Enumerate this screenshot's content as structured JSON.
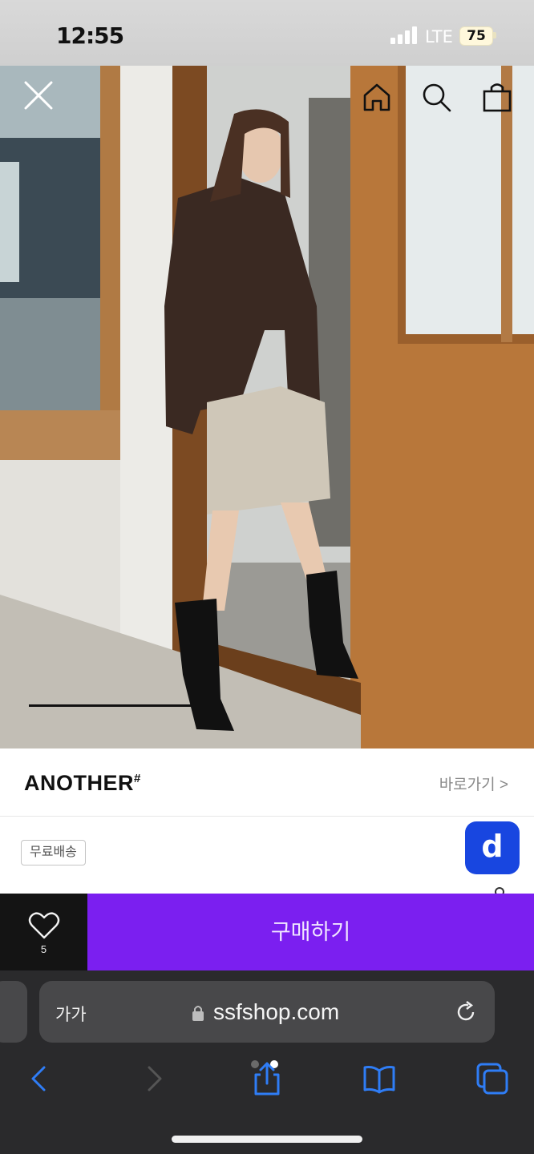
{
  "status_bar": {
    "time": "12:55",
    "network": "LTE",
    "battery": "75"
  },
  "top_icons": [
    "close-icon",
    "home-icon",
    "search-icon",
    "shopping-bag-icon"
  ],
  "brand": {
    "name": "ANOTHER",
    "mark": "#",
    "link": "바로가기 >"
  },
  "badges": {
    "shipping": "무료배송",
    "app": "d"
  },
  "actions": {
    "wish_count": "5",
    "buy": "구매하기"
  },
  "safari": {
    "aa": "가가",
    "url": "ssfshop.com",
    "toolbar": [
      "back-icon",
      "forward-icon",
      "share-icon",
      "bookmarks-icon",
      "tabs-icon"
    ]
  },
  "colors": {
    "buy_bg": "#7b1ff0",
    "wish_bg": "#141414",
    "app_badge": "#1846e0",
    "link_blue": "#2f7df6"
  },
  "image_carousel": {
    "progress": 0.33
  }
}
